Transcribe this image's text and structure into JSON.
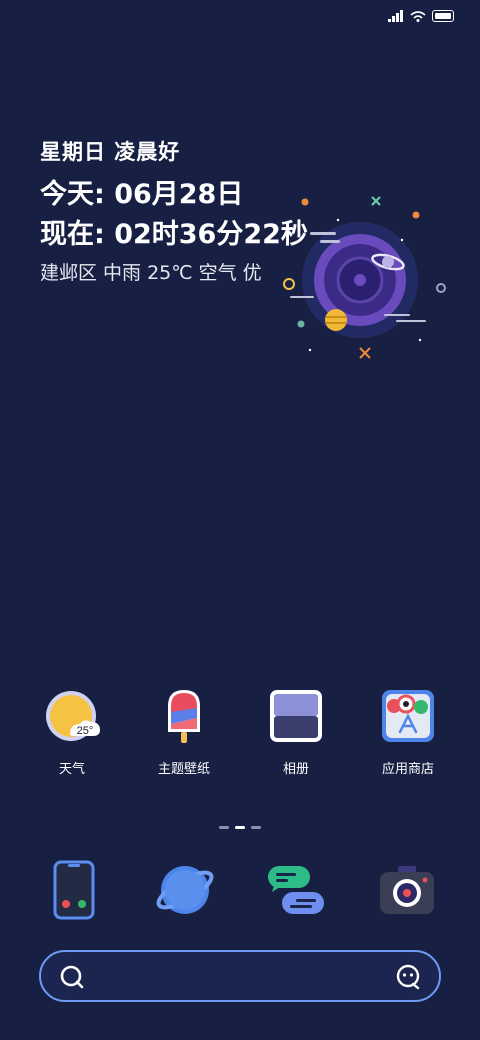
{
  "home": {
    "greeting": "星期日  凌晨好",
    "date": "今天: 06月28日",
    "time": "现在: 02时36分22秒",
    "weather": "建邺区 中雨 25℃ 空气 优"
  },
  "apps": [
    {
      "label": "天气",
      "icon": "weather-icon",
      "badge": "25°"
    },
    {
      "label": "主题壁纸",
      "icon": "theme-icon"
    },
    {
      "label": "相册",
      "icon": "gallery-icon"
    },
    {
      "label": "应用商店",
      "icon": "app-store-icon"
    }
  ],
  "dock": [
    {
      "icon": "phone-icon"
    },
    {
      "icon": "browser-icon"
    },
    {
      "icon": "messages-icon"
    },
    {
      "icon": "camera-icon"
    }
  ],
  "pager": {
    "pages": 3,
    "active_index": 1
  },
  "colors": {
    "background": "#172043",
    "accent": "#6f9bf5"
  }
}
